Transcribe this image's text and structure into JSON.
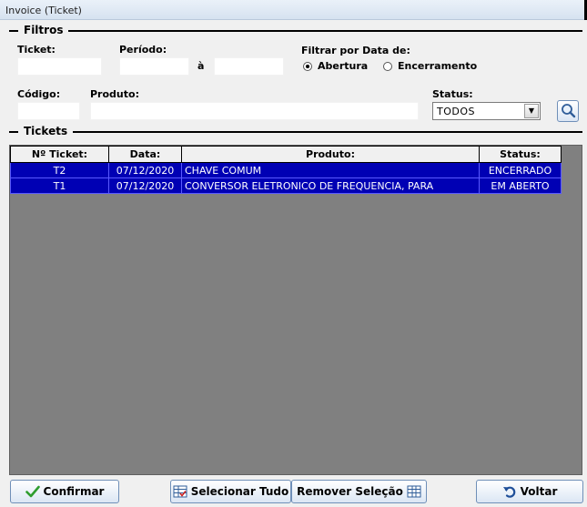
{
  "window": {
    "title": "Invoice (Ticket)"
  },
  "filtros": {
    "group_label": "Filtros",
    "ticket_label": "Ticket:",
    "periodo_label": "Período:",
    "periodo_sep": "à",
    "filtrar_label": "Filtrar por Data de:",
    "radio_abertura": "Abertura",
    "radio_encerramento": "Encerramento",
    "codigo_label": "Código:",
    "produto_label": "Produto:",
    "status_label": "Status:",
    "status_value": "TODOS",
    "ticket_value": "",
    "periodo_inicio": "",
    "periodo_fim": "",
    "codigo_value": "",
    "produto_value": ""
  },
  "tickets": {
    "group_label": "Tickets",
    "columns": [
      "Nº Ticket:",
      "Data:",
      "Produto:",
      "Status:"
    ],
    "rows": [
      {
        "ticket": "T2",
        "data": "07/12/2020",
        "produto": "CHAVE COMUM",
        "status": "ENCERRADO"
      },
      {
        "ticket": "T1",
        "data": "07/12/2020",
        "produto": "CONVERSOR ELETRONICO DE FREQUENCIA, PARA",
        "status": "EM ABERTO"
      }
    ]
  },
  "buttons": {
    "confirmar": "Confirmar",
    "selecionar_tudo": "Selecionar Tudo",
    "remover_selecao": "Remover Seleção",
    "voltar": "Voltar"
  },
  "colors": {
    "row_selected": "#0000b4",
    "grid_background": "#808080",
    "window_background": "#f0f0f0"
  }
}
